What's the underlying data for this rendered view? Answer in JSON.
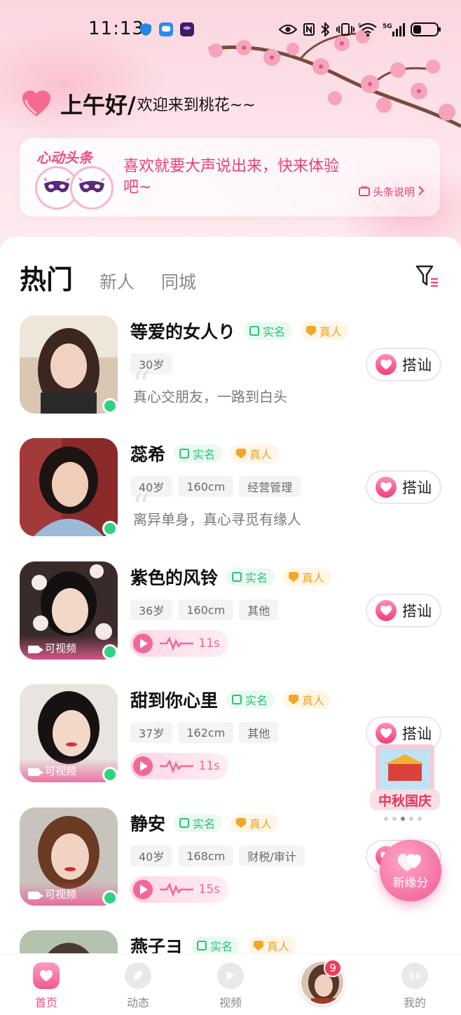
{
  "status_bar": {
    "time": "11:13",
    "network": "5G",
    "wifi": "6"
  },
  "greeting": {
    "main": "上午好/",
    "sub": "欢迎来到桃花~~"
  },
  "headline": {
    "tag": "心动头条",
    "message": "喜欢就要大声说出来，快来体验吧~",
    "help_label": "头条说明"
  },
  "tabs": [
    {
      "label": "热门",
      "active": true
    },
    {
      "label": "新人",
      "active": false
    },
    {
      "label": "同城",
      "active": false
    }
  ],
  "badges": {
    "real_name": "实名",
    "real_person": "真人"
  },
  "greet_button_label": "搭讪",
  "video_label": "可视频",
  "users": [
    {
      "name": "等爱的女人り",
      "tags": [
        "30岁"
      ],
      "bio": "真心交朋友，一路到白头",
      "online": true
    },
    {
      "name": "蕊希",
      "tags": [
        "40岁",
        "160cm",
        "经营管理"
      ],
      "bio": "离异单身，真心寻觅有缘人",
      "online": true
    },
    {
      "name": "紫色的风铃",
      "tags": [
        "36岁",
        "160cm",
        "其他"
      ],
      "voice_duration": "11s",
      "video": true,
      "online": true
    },
    {
      "name": "甜到你心里",
      "tags": [
        "37岁",
        "162cm",
        "其他"
      ],
      "voice_duration": "11s",
      "video": true,
      "online": true
    },
    {
      "name": "静安",
      "tags": [
        "40岁",
        "168cm",
        "财税/审计"
      ],
      "voice_duration": "15s",
      "video": true,
      "online": true
    },
    {
      "name": "燕子ヨ",
      "tags": [],
      "online": false
    }
  ],
  "promo": {
    "label": "中秋国庆"
  },
  "fate_button": {
    "label": "新缘分"
  },
  "nav": {
    "home": "首页",
    "moments": "动态",
    "video": "视频",
    "messages_badge": "9",
    "mine": "我的"
  },
  "colors": {
    "accent": "#f04b86",
    "online": "#2fd37f",
    "real_badge": "#2bc07a",
    "true_badge": "#f2a11f"
  }
}
